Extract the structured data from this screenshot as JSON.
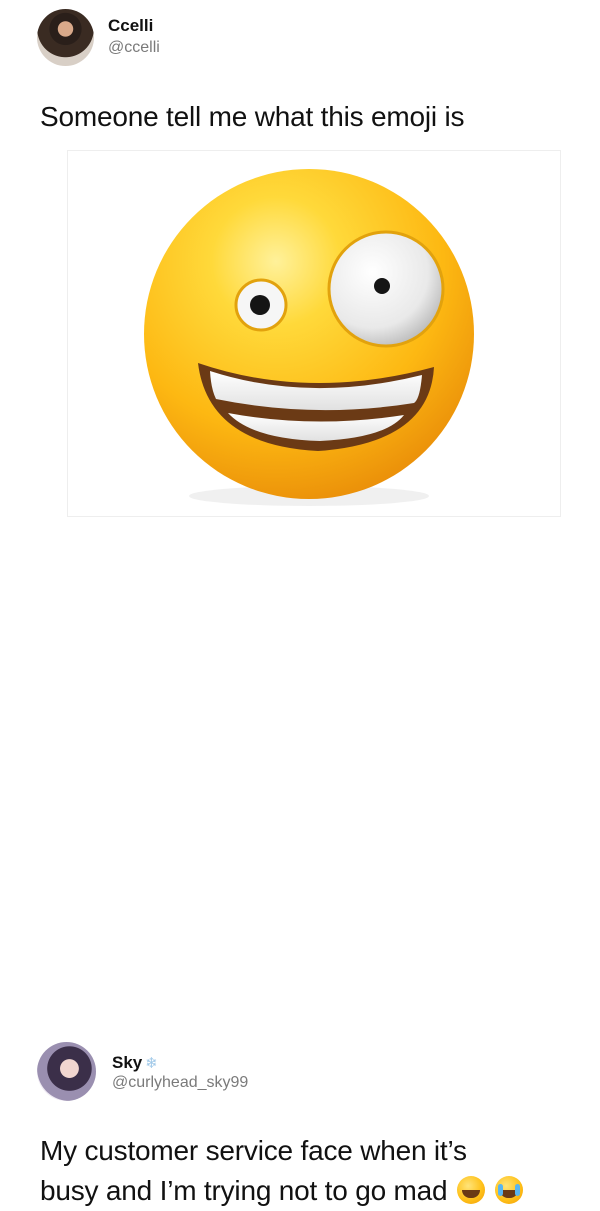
{
  "tweet": {
    "author_name": "Ccelli",
    "author_handle": "@ccelli",
    "text": "Someone tell me what this emoji is",
    "media_icon": "zany-face-emoji"
  },
  "reply": {
    "author_name": "Sky",
    "author_badge_icon": "snowflake-icon",
    "author_handle": "@curlyhead_sky99",
    "text_line1": "My customer service face when it’s",
    "text_line2": "busy and I’m trying not to go mad",
    "trailing_emojis": [
      "face-with-tears-of-joy-emoji",
      "loudly-crying-face-emoji"
    ]
  },
  "colors": {
    "emoji_yellow": "#ffc21a",
    "handle_gray": "#7a7a7a",
    "snowflake_blue": "#9fc8e8"
  }
}
